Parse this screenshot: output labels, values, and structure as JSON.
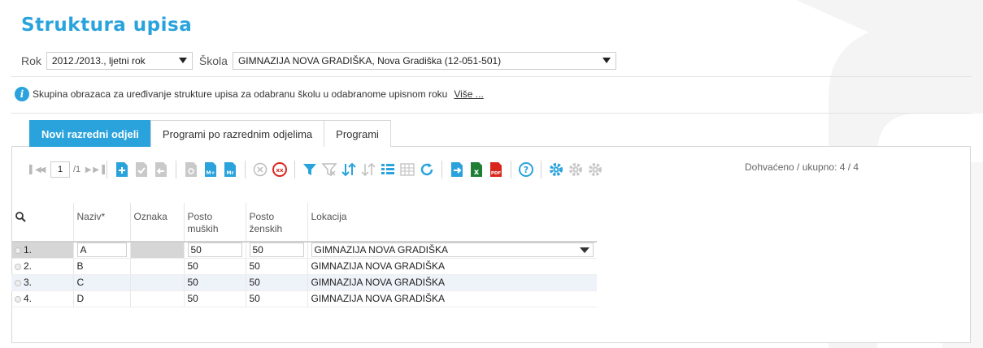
{
  "page": {
    "title": "Struktura upisa"
  },
  "filters": {
    "rok_label": "Rok",
    "rok_value": "2012./2013., ljetni rok",
    "skola_label": "Škola",
    "skola_value": "GIMNAZIJA NOVA GRADIŠKA, Nova Gradiška (12-051-501)"
  },
  "info": {
    "text": "Skupina obrazaca za uređivanje strukture upisa za odabranu školu u odabranome upisnom roku",
    "more_link": "Više ..."
  },
  "tabs": [
    {
      "label": "Novi razredni odjeli",
      "active": true
    },
    {
      "label": "Programi po razrednim odjelima",
      "active": false
    },
    {
      "label": "Programi",
      "active": false
    }
  ],
  "toolbar": {
    "page_value": "1",
    "page_total": "/1",
    "counter": "Dohvaćeno / ukupno: 4 / 4",
    "icons": [
      "first-page-icon",
      "prev-page-icon",
      "next-page-icon",
      "last-page-icon",
      "add-row-icon",
      "save-icon",
      "undo-icon",
      "copy-icon",
      "m-plus-icon",
      "mr-icon",
      "cancel-icon",
      "cancel-all-icon",
      "filter-icon",
      "clear-filter-icon",
      "sort-icon",
      "clear-sort-icon",
      "columns-icon",
      "columns-grid-icon",
      "refresh-icon",
      "export-icon",
      "excel-icon",
      "pdf-icon",
      "help-icon",
      "settings-icon",
      "settings-save-icon",
      "settings-reset-icon"
    ]
  },
  "grid": {
    "columns": [
      "Naziv*",
      "Oznaka",
      "Posto muških",
      "Posto ženskih",
      "Lokacija"
    ],
    "col_posto_m": [
      "Posto",
      "muških"
    ],
    "col_posto_z": [
      "Posto",
      "ženskih"
    ],
    "rows": [
      {
        "num": "1.",
        "naziv": "A",
        "oznaka": "",
        "muskih": "50",
        "zenskih": "50",
        "lokacija": "GIMNAZIJA NOVA GRADIŠKA"
      },
      {
        "num": "2.",
        "naziv": "B",
        "oznaka": "",
        "muskih": "50",
        "zenskih": "50",
        "lokacija": "GIMNAZIJA NOVA GRADIŠKA"
      },
      {
        "num": "3.",
        "naziv": "C",
        "oznaka": "",
        "muskih": "50",
        "zenskih": "50",
        "lokacija": "GIMNAZIJA NOVA GRADIŠKA"
      },
      {
        "num": "4.",
        "naziv": "D",
        "oznaka": "",
        "muskih": "50",
        "zenskih": "50",
        "lokacija": "GIMNAZIJA NOVA GRADIŠKA"
      }
    ]
  },
  "colors": {
    "accent": "#2aa3dc",
    "excel": "#1e7e34",
    "pdf": "#d9261c",
    "gear": "#2aa3dc",
    "cancel_all": "#d9261c"
  }
}
